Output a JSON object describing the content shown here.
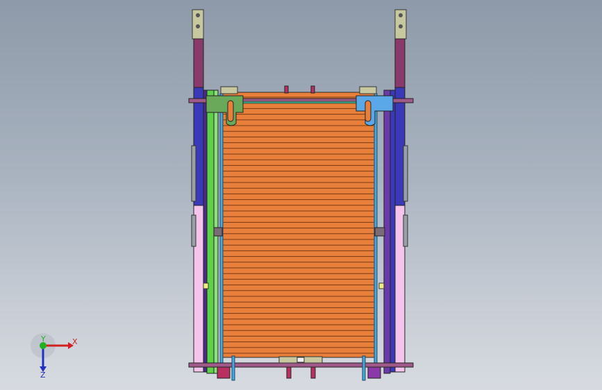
{
  "viewport": {
    "background_top": "#8e9aa9",
    "background_bottom": "#d7dbe1"
  },
  "model": {
    "colors": {
      "belt": "#e8803c",
      "belt_line": "#7a3a14",
      "frame_outline": "#2a2a2a",
      "green_rail": "#5fd04a",
      "blue_rod": "#4aa8d8",
      "purple_post": "#8a3a6a",
      "navy_rail": "#3a3ab8",
      "pink_post": "#f4c4ec",
      "crossbar": "#a05a8a",
      "green_block": "#6aa85a",
      "blue_block": "#5aa8e8",
      "bracket": "#c8c8a0",
      "yellow_tab": "#f0f080",
      "red_pin": "#b83060"
    }
  },
  "triad": {
    "x_label": "X",
    "y_label": "Y",
    "z_label": "Z",
    "x_color": "#d02020",
    "y_color": "#20b020",
    "z_color": "#2030c0"
  }
}
